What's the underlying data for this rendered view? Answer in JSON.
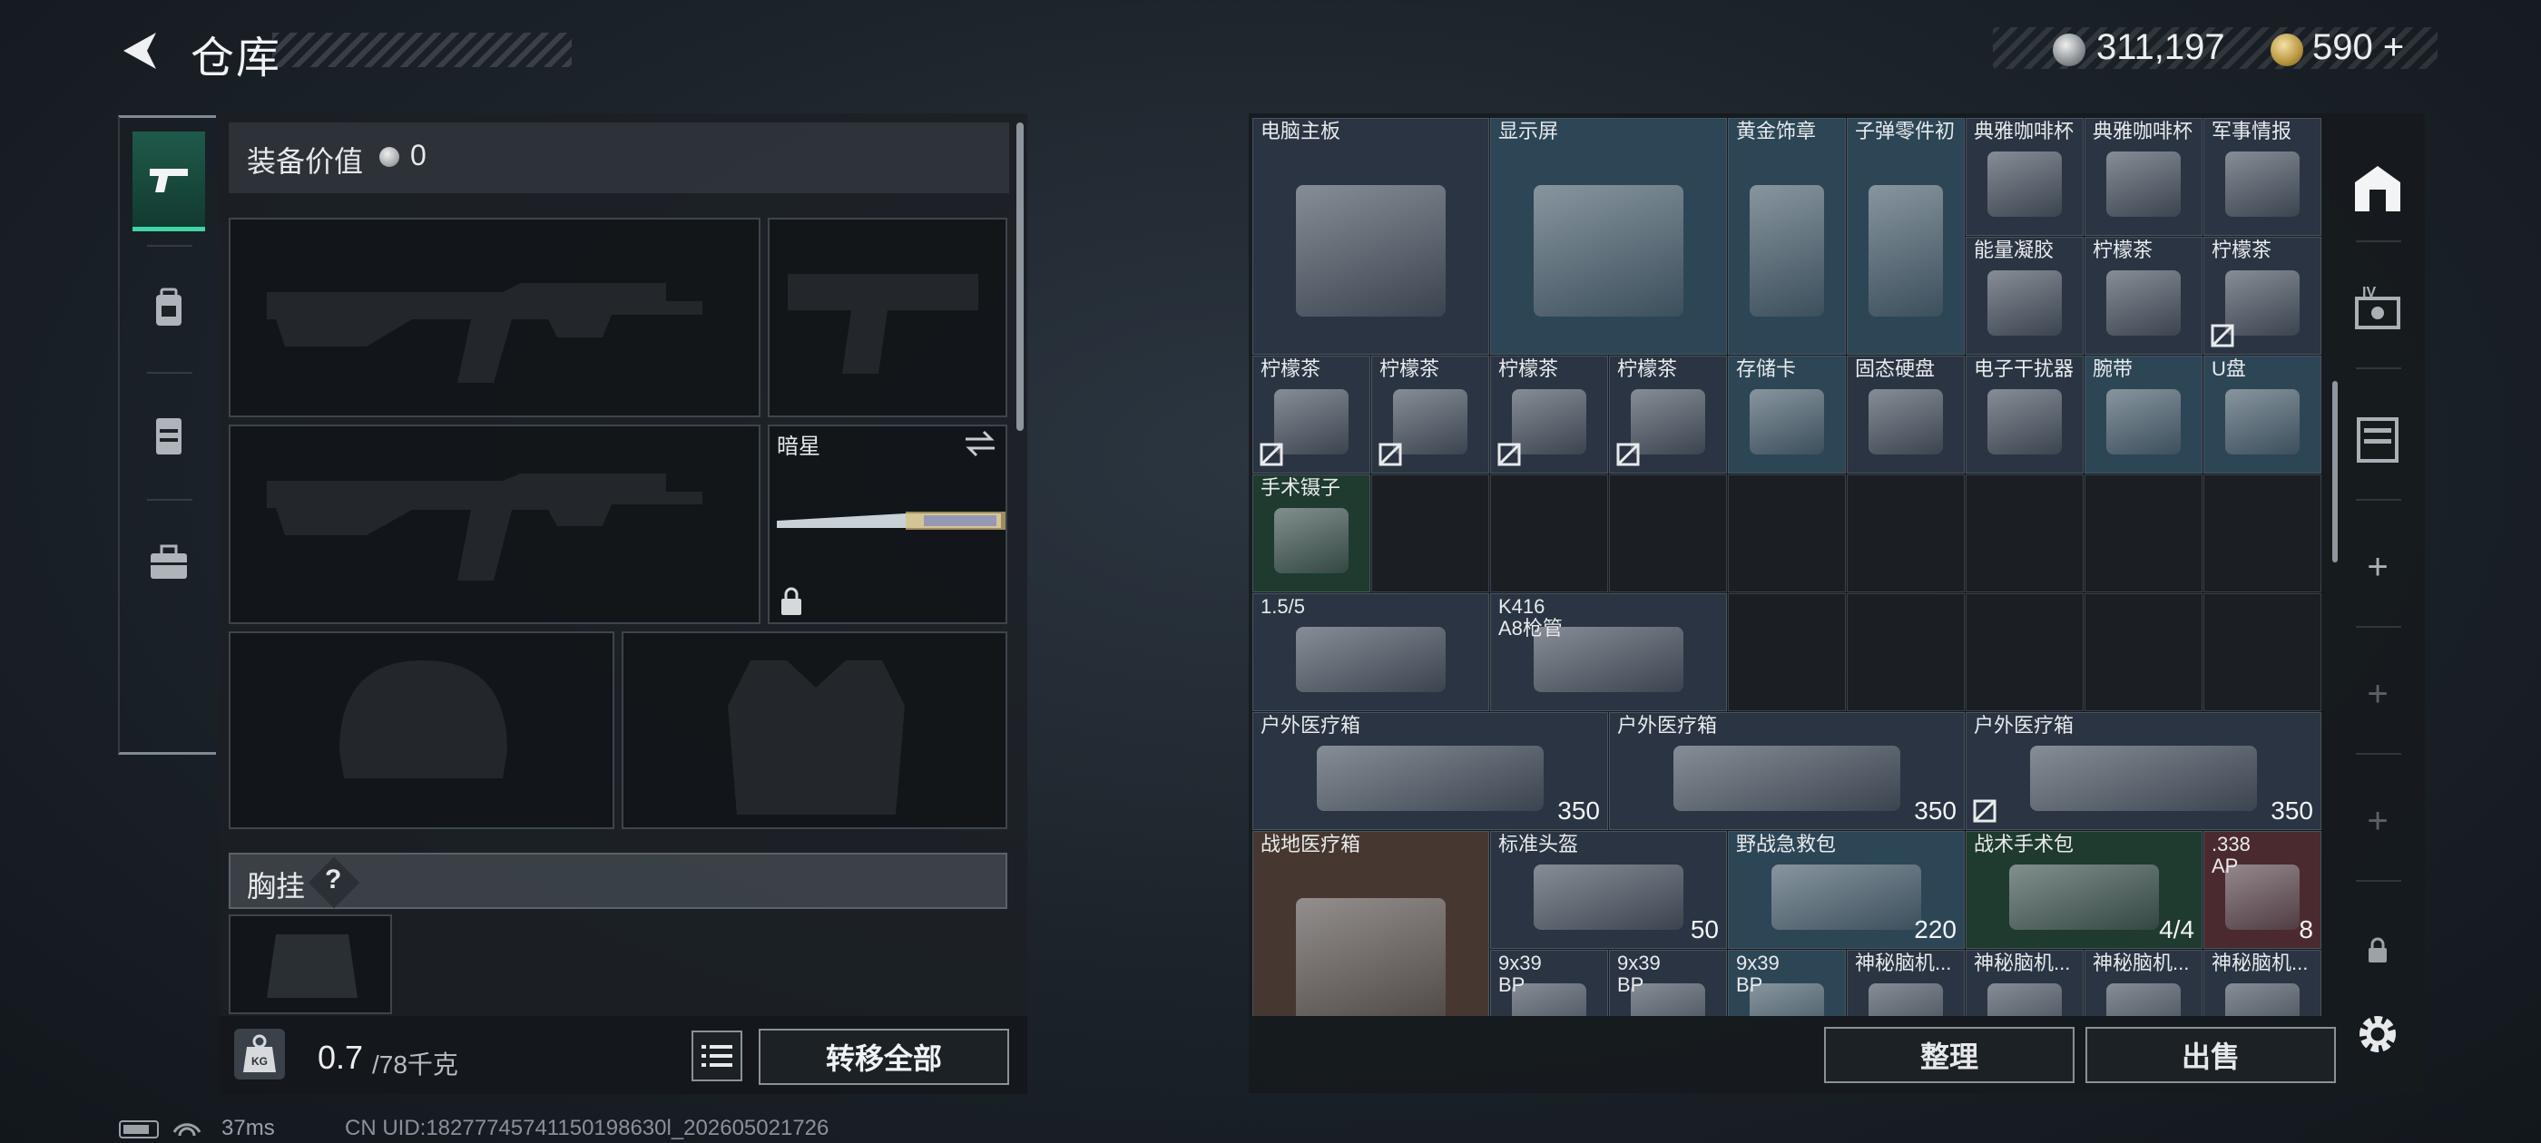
{
  "header": {
    "title": "仓库",
    "silver_amount": "311,197",
    "gold_amount": "590",
    "gold_plus": "+"
  },
  "left_nav": {
    "items": [
      "pistol-icon",
      "backpack-icon",
      "rig-icon",
      "toolbox-icon"
    ],
    "active": "pistol-icon"
  },
  "loadout": {
    "equipment_value_label": "装备价值",
    "equipment_value": "0",
    "melee_name": "暗星",
    "chest_rig_label": "胸挂",
    "chest_rig_help": "?",
    "weight_current": "0.7",
    "weight_max": "/78千克",
    "transfer_all": "转移全部"
  },
  "status_bar": {
    "ping": "37ms",
    "uid": "CN UID:18277745741150198630l_202605021726"
  },
  "stash": {
    "items": [
      {
        "name": "电脑主板",
        "value": "",
        "nosell": false,
        "color": "#2a3442"
      },
      {
        "name": "显示屏",
        "value": "",
        "nosell": false,
        "color": "#2c4656"
      },
      {
        "name": "黄金饰章",
        "value": "",
        "nosell": false,
        "color": "#2c4656"
      },
      {
        "name": "子弹零件初",
        "value": "",
        "nosell": false,
        "color": "#2c4656"
      },
      {
        "name": "典雅咖啡杯",
        "value": "",
        "nosell": false,
        "color": "#2a3442"
      },
      {
        "name": "典雅咖啡杯",
        "value": "",
        "nosell": false,
        "color": "#2a3442"
      },
      {
        "name": "军事情报",
        "value": "",
        "nosell": false,
        "color": "#2a3442"
      },
      {
        "name": "能量凝胶",
        "value": "",
        "nosell": false,
        "color": "#2a3442"
      },
      {
        "name": "柠檬茶",
        "value": "",
        "nosell": false,
        "color": "#2a3442"
      },
      {
        "name": "柠檬茶",
        "value": "",
        "nosell": true,
        "color": "#2a3442"
      },
      {
        "name": "柠檬茶",
        "value": "",
        "nosell": true,
        "color": "#2a3442"
      },
      {
        "name": "柠檬茶",
        "value": "",
        "nosell": true,
        "color": "#2a3442"
      },
      {
        "name": "柠檬茶",
        "value": "",
        "nosell": true,
        "color": "#2a3442"
      },
      {
        "name": "柠檬茶",
        "value": "",
        "nosell": true,
        "color": "#2a3442"
      },
      {
        "name": "固态硬盘",
        "value": "",
        "nosell": false,
        "color": "#2a3442"
      },
      {
        "name": "电子干扰器",
        "value": "",
        "nosell": false,
        "color": "#2a3442"
      },
      {
        "name": "腕带",
        "value": "",
        "nosell": false,
        "color": "#2c4656"
      },
      {
        "name": "U盘",
        "value": "",
        "nosell": false,
        "color": "#2c4656"
      },
      {
        "name": "存储卡",
        "value": "",
        "nosell": false,
        "color": "#2c4656"
      },
      {
        "name": "手术镊子",
        "value": "",
        "nosell": false,
        "color": "#1f3a2e"
      },
      {
        "name": "1.5/5",
        "value": "",
        "nosell": false,
        "color": "#2a3442"
      },
      {
        "name": "K416\nA8枪管",
        "value": "",
        "nosell": false,
        "color": "#2a3442"
      },
      {
        "name": "户外医疗箱",
        "value": "350",
        "nosell": false,
        "color": "#2a3442"
      },
      {
        "name": "户外医疗箱",
        "value": "350",
        "nosell": false,
        "color": "#2a3442"
      },
      {
        "name": "户外医疗箱",
        "value": "350",
        "nosell": true,
        "color": "#2a3442"
      },
      {
        "name": "战地医疗箱",
        "value": "",
        "nosell": false,
        "color": "#463830"
      },
      {
        "name": "标准头盔",
        "value": "50",
        "nosell": false,
        "color": "#2a3442"
      },
      {
        "name": "野战急救包",
        "value": "220",
        "nosell": false,
        "color": "#2c4656"
      },
      {
        "name": "战术手术包",
        "value": "4/4",
        "nosell": false,
        "color": "#1f3a2e"
      },
      {
        "name": ".338\nAP",
        "value": "8",
        "nosell": false,
        "color": "#4a2a2e"
      },
      {
        "name": "9x39\nBP",
        "value": "",
        "nosell": false,
        "color": "#2a3442"
      },
      {
        "name": "9x39\nBP",
        "value": "",
        "nosell": false,
        "color": "#2a3442"
      },
      {
        "name": "9x39\nBP",
        "value": "",
        "nosell": false,
        "color": "#2c4656"
      },
      {
        "name": "神秘脑机...",
        "value": "",
        "nosell": false,
        "color": "#2a3442"
      },
      {
        "name": "神秘脑机...",
        "value": "",
        "nosell": false,
        "color": "#2a3442"
      },
      {
        "name": "神秘脑机...",
        "value": "",
        "nosell": false,
        "color": "#2a3442"
      },
      {
        "name": "神秘脑机...",
        "value": "",
        "nosell": false,
        "color": "#2a3442"
      }
    ],
    "sort_label": "整理",
    "sell_label": "出售"
  },
  "right_nav": {
    "items": [
      "stash-home-icon",
      "level-box-icon",
      "case-icon",
      "add-icon",
      "add-icon",
      "add-icon",
      "lock-icon",
      "settings-icon"
    ]
  },
  "colors": {
    "accent_green": "#3fd6a4",
    "panel": "#1c2126"
  }
}
